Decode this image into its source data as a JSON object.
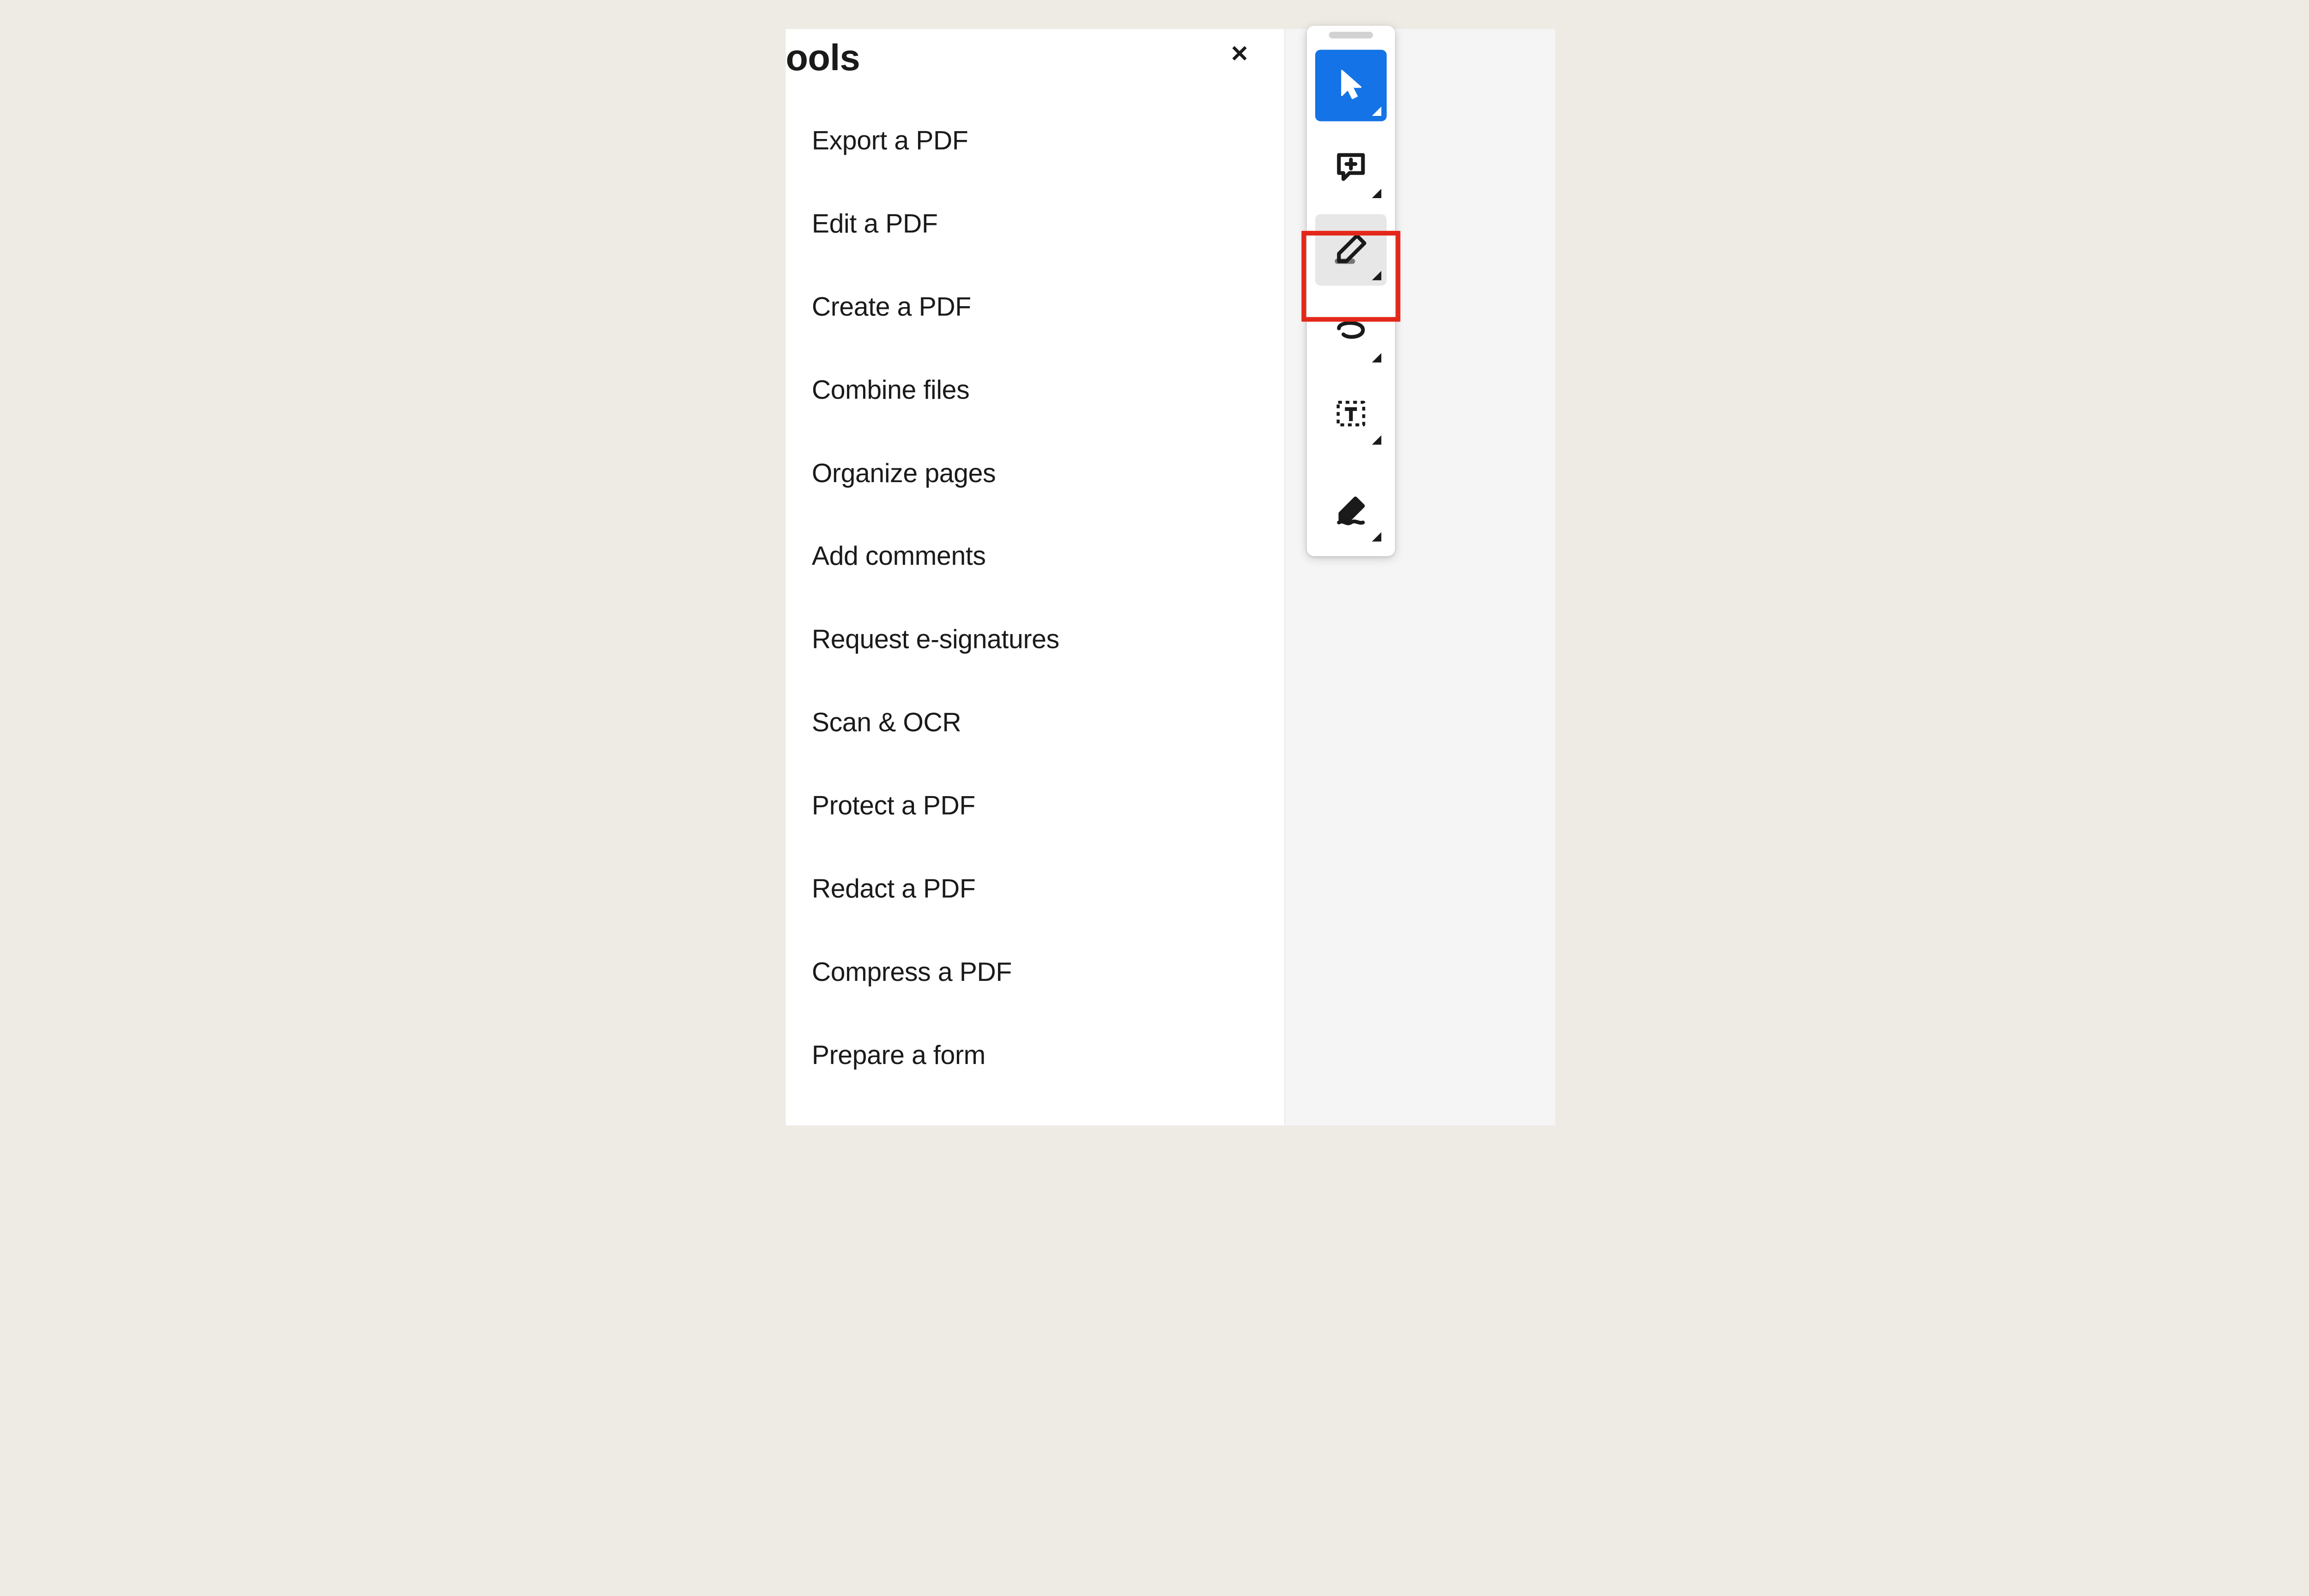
{
  "panel": {
    "title_fragment": "ools",
    "items": [
      "Export a PDF",
      "Edit a PDF",
      "Create a PDF",
      "Combine files",
      "Organize pages",
      "Add comments",
      "Request e-signatures",
      "Scan & OCR",
      "Protect a PDF",
      "Redact a PDF",
      "Compress a PDF",
      "Prepare a form"
    ]
  },
  "toolbar": {
    "buttons": [
      {
        "name": "select-tool",
        "state": "active"
      },
      {
        "name": "add-comment-tool",
        "state": "normal"
      },
      {
        "name": "highlight-tool",
        "state": "hovered-marked"
      },
      {
        "name": "draw-freeform-tool",
        "state": "normal"
      },
      {
        "name": "add-text-box-tool",
        "state": "normal"
      },
      {
        "name": "fill-sign-tool",
        "state": "normal"
      }
    ]
  },
  "colors": {
    "accent": "#1473e6",
    "highlight_border": "#e3281b",
    "panel_bg": "#ffffff",
    "page_bg": "#eeeae4",
    "right_bg": "#f5f5f5"
  }
}
